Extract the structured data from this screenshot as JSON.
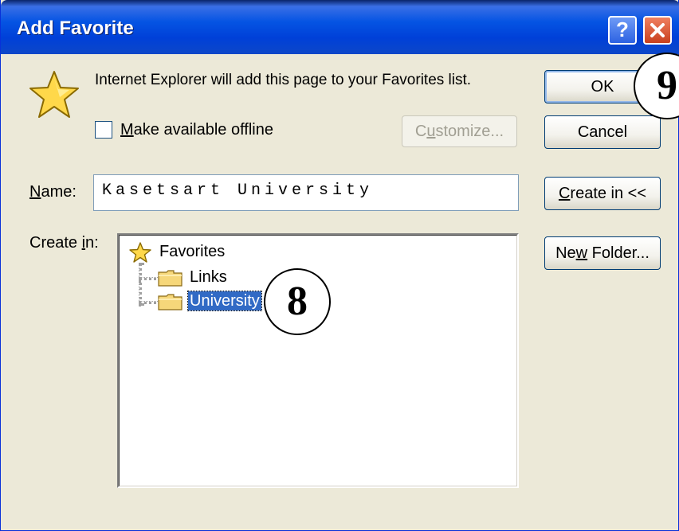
{
  "window": {
    "title": "Add Favorite"
  },
  "titlebar": {
    "help_label": "?",
    "close_label": "close"
  },
  "message": "Internet Explorer will add this page to your Favorites list.",
  "offline": {
    "checked": false,
    "label_prefix": "",
    "label_mnemonic": "M",
    "label_rest": "ake available offline"
  },
  "buttons": {
    "ok": "OK",
    "cancel": "Cancel",
    "customize_pre": "C",
    "customize_mn": "u",
    "customize_post": "stomize...",
    "createin_pre": "",
    "createin_mn": "C",
    "createin_post": "reate in <<",
    "newfolder_pre": "Ne",
    "newfolder_mn": "w",
    "newfolder_post": " Folder..."
  },
  "name_field": {
    "label_mn": "N",
    "label_rest": "ame:",
    "value": "Kasetsart University"
  },
  "create_in": {
    "label_pre": "Create ",
    "label_mn": "i",
    "label_post": "n:"
  },
  "tree": {
    "root": "Favorites",
    "children": [
      "Links",
      "University"
    ],
    "selected": "University"
  },
  "callouts": {
    "eight": "8",
    "nine": "9"
  },
  "colors": {
    "titlebar": "#0554e3",
    "dialog_bg": "#ece9d8",
    "selection": "#316ac5"
  }
}
